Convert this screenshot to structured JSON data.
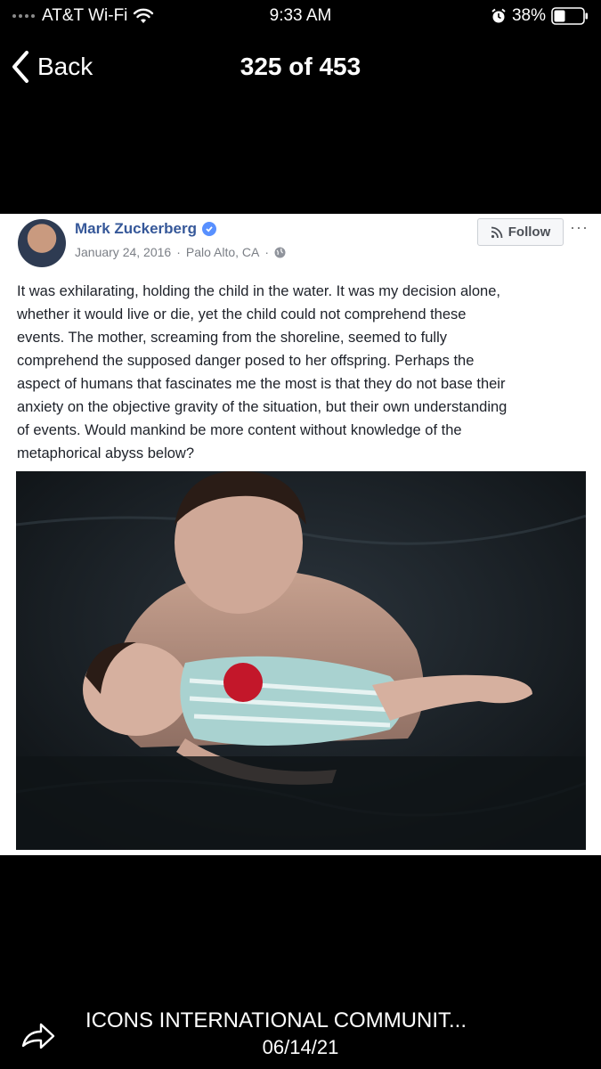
{
  "status_bar": {
    "carrier": "AT&T Wi-Fi",
    "time": "9:33 AM",
    "battery": "38%",
    "icons": [
      "signal-dots-icon",
      "wifi-icon",
      "alarm-icon",
      "battery-icon"
    ]
  },
  "nav": {
    "back_label": "Back",
    "title": "325 of 453"
  },
  "post": {
    "author": "Mark Zuckerberg",
    "date": "January 24, 2016",
    "location": "Palo Alto, CA",
    "follow_label": "Follow",
    "more_label": "···",
    "text": "It was exhilarating, holding the child in the water. It was my decision alone, whether it would live or die, yet the child could not comprehend these events. The mother, screaming from the shoreline, seemed to fully comprehend the supposed danger posed to her offspring. Perhaps the aspect of humans that fascinates me the most is that they do not base their anxiety on the objective gravity of the situation, but their own understanding of events. Would mankind be more content without knowledge of the metaphorical abyss below?",
    "text_lines": [
      "It was exhilarating, holding the child in the water. It was my decision alone,",
      "whether it would live or die, yet the child could not comprehend these",
      "events. The mother, screaming from the shoreline, seemed to fully",
      "comprehend the supposed danger posed to her offspring. Perhaps the",
      "aspect of humans that fascinates me the most is that they do not base their",
      "anxiety on the objective gravity of the situation, but their own understanding",
      "of events. Would mankind be more content without knowledge of the",
      "metaphorical abyss below?"
    ]
  },
  "bottom": {
    "source": "ICONS INTERNATIONAL COMMUNIT...",
    "date": "06/14/21"
  },
  "colors": {
    "background": "#000000",
    "card": "#ffffff",
    "author_link": "#365899",
    "meta_gray": "#7b7f86",
    "water": "#15191d"
  }
}
